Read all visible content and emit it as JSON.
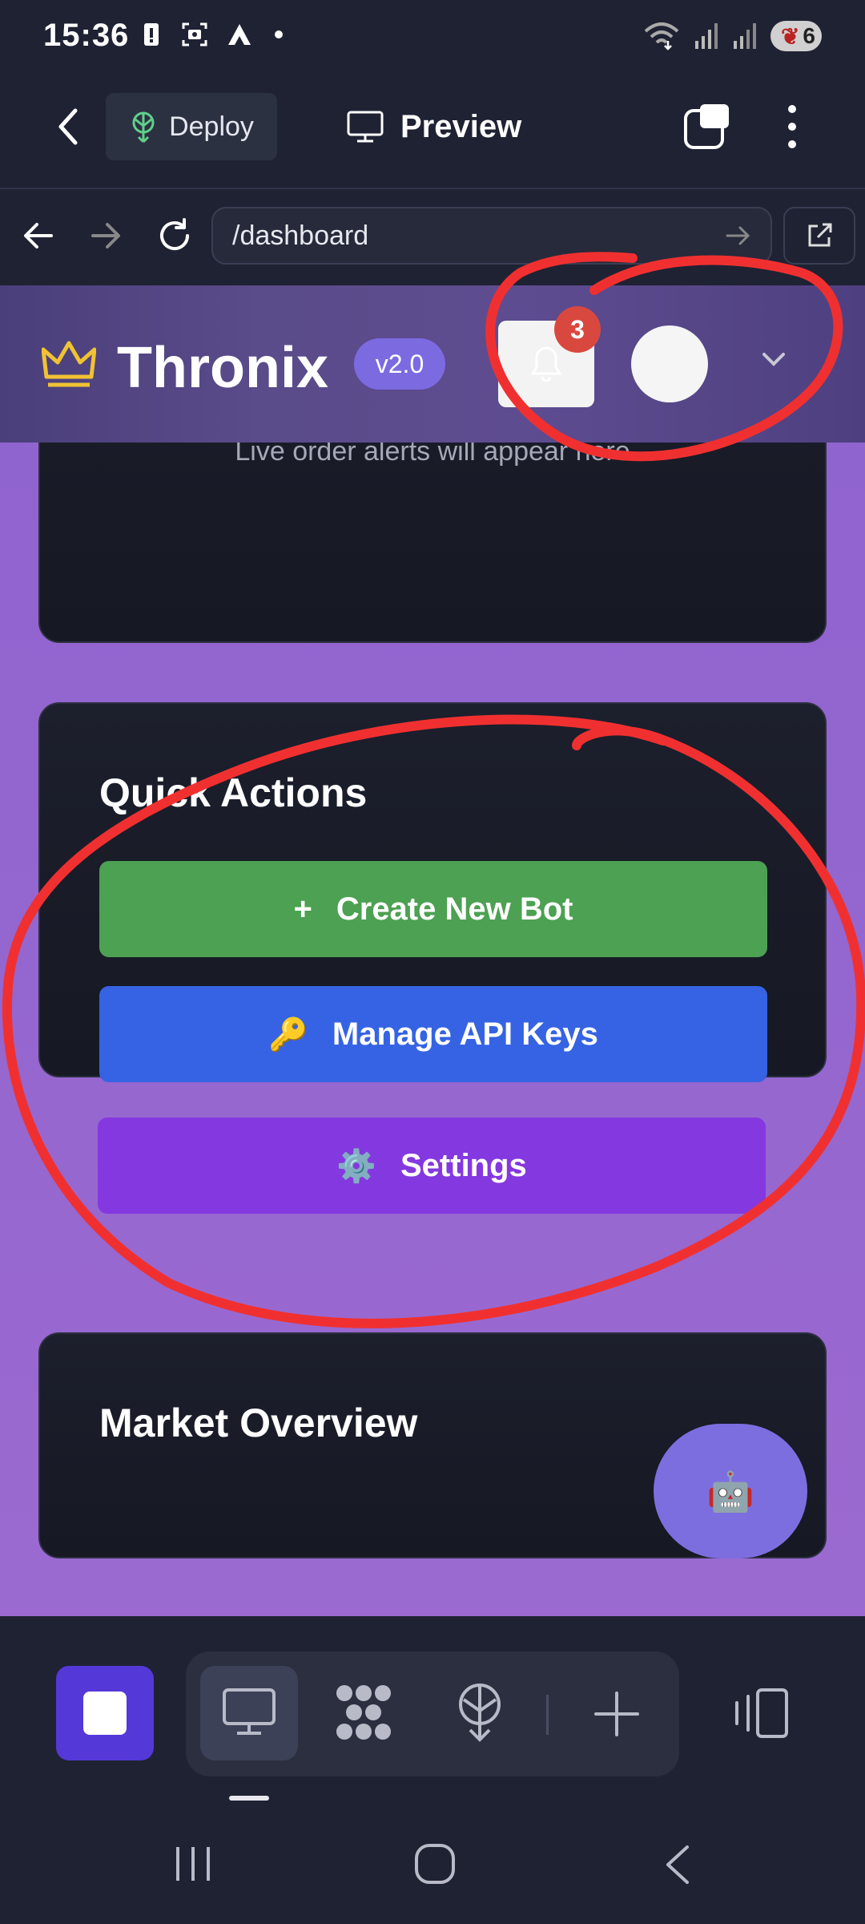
{
  "status_bar": {
    "time": "15:36",
    "battery_level": "6"
  },
  "app_bar": {
    "deploy_label": "Deploy",
    "preview_label": "Preview"
  },
  "browser": {
    "url": "/dashboard"
  },
  "header": {
    "brand": "Thronix",
    "version": "v2.0",
    "notification_count": "3"
  },
  "alerts_card": {
    "placeholder": "Live order alerts will appear here"
  },
  "quick_actions": {
    "title": "Quick Actions",
    "buttons": [
      {
        "icon": "+",
        "label": "Create New Bot",
        "color": "#4ca152"
      },
      {
        "icon": "🔑",
        "label": "Manage API Keys",
        "color": "#3563e3"
      },
      {
        "icon": "⚙️",
        "label": "Settings",
        "color": "#8438e0"
      }
    ]
  },
  "market_card": {
    "title": "Market Overview"
  },
  "fab": {
    "icon": "🤖"
  },
  "colors": {
    "page_bg": "#9466cf",
    "card_bg": "#1a1d29",
    "accent": "#5538d8",
    "annotation": "#f03030"
  }
}
